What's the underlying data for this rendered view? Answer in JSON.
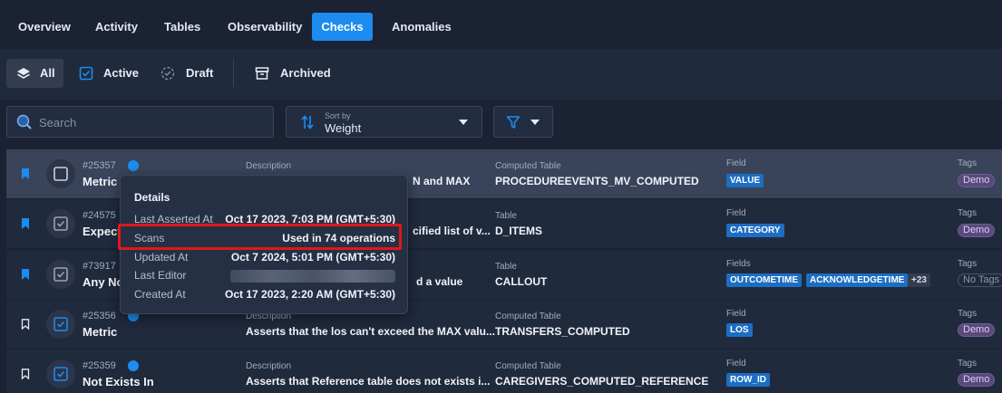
{
  "tabs": [
    "Overview",
    "Activity",
    "Tables",
    "Observability",
    "Checks",
    "Anomalies"
  ],
  "active_tab": "Checks",
  "filters": {
    "all": "All",
    "active": "Active",
    "draft": "Draft",
    "archived": "Archived"
  },
  "search": {
    "placeholder": "Search"
  },
  "sort": {
    "caption": "Sort by",
    "value": "Weight"
  },
  "colors": {
    "accent": "#1c8cf0",
    "chip": "#1c6ec2",
    "highlight": "#e01818"
  },
  "rows": [
    {
      "id": "#25357",
      "type": "Metric",
      "desc_label": "Description",
      "desc": "N and MAX",
      "table_label": "Computed Table",
      "table": "PROCEDUREEVENTS_MV_COMPUTED",
      "field_label": "Field",
      "fields": [
        "VALUE"
      ],
      "tags_label": "Tags",
      "tag": "Demo"
    },
    {
      "id": "#24575",
      "type": "Expect",
      "desc_label": "",
      "desc": "cified list of v...",
      "table_label": "Table",
      "table": "D_ITEMS",
      "field_label": "Field",
      "fields": [
        "CATEGORY"
      ],
      "tags_label": "Tags",
      "tag": "Demo"
    },
    {
      "id": "#73917",
      "type": "Any Not",
      "desc_label": "",
      "desc": "d a value",
      "table_label": "Table",
      "table": "CALLOUT",
      "field_label": "Fields",
      "fields": [
        "OUTCOMETIME",
        "ACKNOWLEDGETIME"
      ],
      "more": "+23",
      "tags_label": "Tags",
      "tag": "No Tags"
    },
    {
      "id": "#25356",
      "type": "Metric",
      "desc_label": "Description",
      "desc": "Asserts that the los can't exceed the MAX valu...",
      "table_label": "Computed Table",
      "table": "TRANSFERS_COMPUTED",
      "field_label": "Field",
      "fields": [
        "LOS"
      ],
      "tags_label": "Tags",
      "tag": "Demo"
    },
    {
      "id": "#25359",
      "type": "Not Exists In",
      "desc_label": "Description",
      "desc": "Asserts that Reference table does not exists i...",
      "table_label": "Computed Table",
      "table": "CAREGIVERS_COMPUTED_REFERENCE",
      "field_label": "Field",
      "fields": [
        "ROW_ID"
      ],
      "tags_label": "Tags",
      "tag": "Demo"
    }
  ],
  "popover": {
    "title": "Details",
    "items": [
      {
        "key": "Last Asserted At",
        "value": "Oct 17 2023, 7:03 PM (GMT+5:30)"
      },
      {
        "key": "Scans",
        "value": "Used in 74 operations"
      },
      {
        "key": "Updated At",
        "value": "Oct 7 2024, 5:01 PM (GMT+5:30)"
      },
      {
        "key": "Last Editor",
        "value": ""
      },
      {
        "key": "Created At",
        "value": "Oct 17 2023, 2:20 AM (GMT+5:30)"
      }
    ]
  }
}
